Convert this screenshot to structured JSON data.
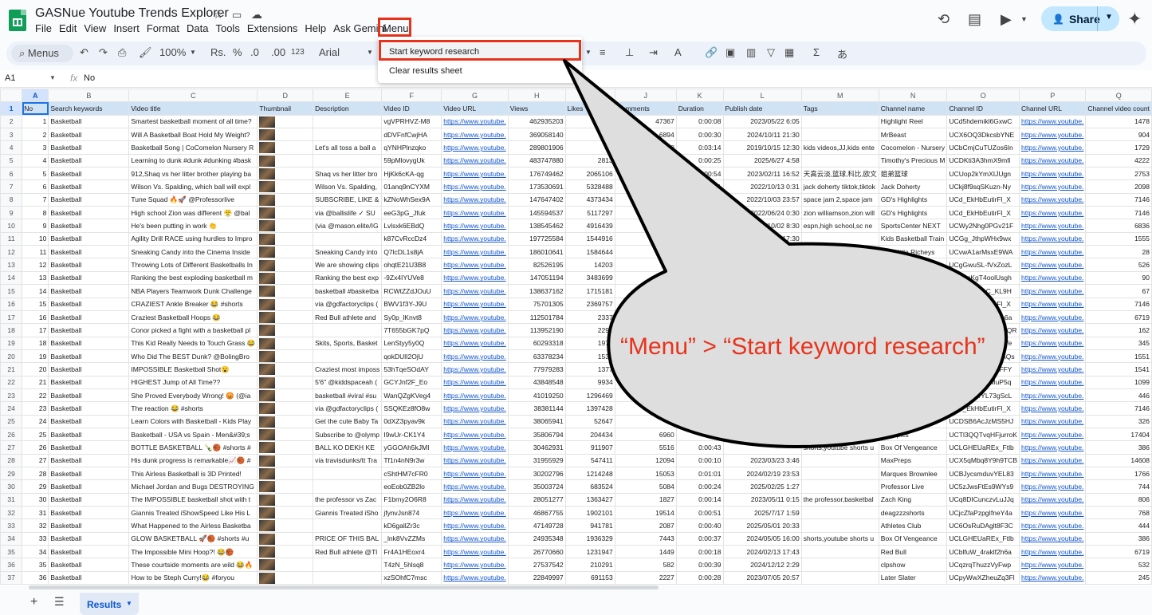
{
  "app": {
    "title": "GASNue Youtube Trends Explorer",
    "menu": [
      "File",
      "Edit",
      "View",
      "Insert",
      "Format",
      "Data",
      "Tools",
      "Extensions",
      "Help",
      "Ask Gemini"
    ],
    "custom_menu": "Menu",
    "share_label": "Share"
  },
  "toolbar": {
    "search_label": "Menus",
    "zoom": "100%",
    "currency": "Rs.",
    "percent": "%",
    "dec_decrease": ".0",
    "dec_increase": ".00",
    "number_format": "123",
    "font": "Arial",
    "input_tool": "あ"
  },
  "formula_bar": {
    "cell_ref": "A1",
    "fx": "fx",
    "value": "No"
  },
  "dropdown": {
    "items": [
      "Start keyword research",
      "Clear results sheet"
    ]
  },
  "callout": {
    "text": "“Menu” > “Start keyword research”"
  },
  "sheet": {
    "column_letters": [
      "A",
      "B",
      "C",
      "D",
      "E",
      "F",
      "G",
      "H",
      "I",
      "J",
      "K",
      "L",
      "M",
      "N",
      "O",
      "P",
      "Q"
    ],
    "headers": [
      "No",
      "Search keywords",
      "Video title",
      "Thumbnail",
      "Description",
      "Video ID",
      "Video URL",
      "Views",
      "Likes",
      "Comments",
      "Duration",
      "Publish date",
      "Tags",
      "Channel name",
      "Channel ID",
      "Channel URL",
      "Channel video count"
    ],
    "rows": [
      [
        "1",
        "Basketball",
        "Smartest basketball moment of all time?",
        "",
        "",
        "vgVPRHVZ-M8",
        "https://www.youtube.",
        "462935203",
        "",
        "47367",
        "0:00:08",
        "2023/05/22 6:05",
        "",
        "Highlight Reel",
        "UCd5hdemikl6GxwC",
        "https://www.youtube.",
        "1478"
      ],
      [
        "2",
        "Basketball",
        "Will A Basketball Boat Hold My Weight?",
        "",
        "",
        "dDVFnfCwjHA",
        "https://www.youtube.",
        "369058140",
        "",
        "6894",
        "0:00:30",
        "2024/10/11 21:30",
        "",
        "MrBeast",
        "UCX6OQ3DkcsbYNE",
        "https://www.youtube.",
        "904"
      ],
      [
        "3",
        "Basketball",
        "Basketball Song | CoComelon Nursery R",
        "",
        "Let's all toss a ball a",
        "qYNHPlnzqko",
        "https://www.youtube.",
        "289801906",
        "",
        "0",
        "0:03:14",
        "2019/10/15 12:30",
        "kids videos,JJ,kids ente",
        "Cocomelon - Nursery",
        "UCbCmjCuTUZos6In",
        "https://www.youtube.",
        "1729"
      ],
      [
        "4",
        "Basketball",
        "Learning to dunk #dunk #dunking #bask",
        "",
        "",
        "59pMlovygUk",
        "https://www.youtube.",
        "483747880",
        "2813",
        "",
        "0:00:25",
        "2025/6/27 4:58",
        "",
        "Timothy's Precious M",
        "UCDKti3A3hmX9mfi",
        "https://www.youtube.",
        "4222"
      ],
      [
        "5",
        "Basketball",
        "912,Shaq vs her litter brother playing ba",
        "",
        "Shaq vs her litter bro",
        "HjKk6cKA-qg",
        "https://www.youtube.",
        "176749462",
        "2065106",
        "",
        "0:00:54",
        "2023/02/11 16:52",
        "天高云淡,篮球,科比,欧文",
        "姐弟篮球",
        "UCUop2kYmXIJUgn",
        "https://www.youtube.",
        "2753"
      ],
      [
        "6",
        "Basketball",
        "Wilson Vs. Spalding, which ball will expl",
        "",
        "Wilson Vs. Spalding,",
        "01anq9nCYXM",
        "https://www.youtube.",
        "173530691",
        "5328488",
        "",
        "0:00:51",
        "2022/10/13 0:31",
        "jack doherty tiktok,tiktok",
        "Jack Doherty",
        "UCkj8f9sqSKuzn-Ny",
        "https://www.youtube.",
        "2098"
      ],
      [
        "7",
        "Basketball",
        "Tune Squad 🔥🚀 @Professorlive",
        "",
        "SUBSCRIBE, LIKE &",
        "kZNoWhSex9A",
        "https://www.youtube.",
        "147647402",
        "4373434",
        "",
        "0:00:29",
        "2022/10/03 23:57",
        "space jam 2,space jam",
        "GD's Highlights",
        "UCd_EkHbEutirFl_X",
        "https://www.youtube.",
        "7146"
      ],
      [
        "8",
        "Basketball",
        "High school Zion was different 😤 @bal",
        "",
        "via @ballislife ✓ SU",
        "eeG3pG_Jfuk",
        "https://www.youtube.",
        "145594537",
        "5117297",
        "",
        "0:00:47",
        "2022/06/24 0:30",
        "zion williamson,zion will",
        "GD's Highlights",
        "UCd_EkHbEutirFl_X",
        "https://www.youtube.",
        "7146"
      ],
      [
        "9",
        "Basketball",
        "He's been putting in work 👏",
        "",
        "(via @mason.elite/IG",
        "Lvlsxk6EBdQ",
        "https://www.youtube.",
        "138545462",
        "4916439",
        "",
        "0:00:59",
        "2022/10/02 8:30",
        "espn,high school,sc ne",
        "SportsCenter NEXT",
        "UCWy2Nhg0PGv21F",
        "https://www.youtube.",
        "6836"
      ],
      [
        "10",
        "Basketball",
        "Agility Drill RACE using hurdles to Impro",
        "",
        "",
        "k87CvRccDz4",
        "https://www.youtube.",
        "197725584",
        "1544916",
        "",
        "0:00:30",
        "2024/05/13 17:30",
        "",
        "Kids Basketball Train",
        "UCGg_JthpWHx9wx",
        "https://www.youtube.",
        "1555"
      ],
      [
        "11",
        "Basketball",
        "Sneaking Candy into the Cinema Inside",
        "",
        "Sneaking Candy into",
        "Q7lcDL1s8jA",
        "https://www.youtube.",
        "186010641",
        "1584644",
        "",
        "",
        "",
        "",
        "The Little Richeys",
        "UCvwA1arMsxE9WA",
        "https://www.youtube.",
        "28"
      ],
      [
        "12",
        "Basketball",
        "Throwing Lots of Different Basketballs In",
        "",
        "We are showing clips",
        "ohqtE21U3B8",
        "https://www.youtube.",
        "82526195",
        "14203",
        "",
        "",
        "",
        "",
        "Dyssa The E",
        "UCgGwuSL-fVxZozL",
        "https://www.youtube.",
        "526"
      ],
      [
        "13",
        "Basketball",
        "Ranking the best exploding basketball m",
        "",
        "Ranking the best exp",
        "-9Zx4IYUVe8",
        "https://www.youtube.",
        "147051194",
        "3483699",
        "",
        "",
        "",
        "",
        "",
        "UCCkcKgT4oolUsgh",
        "https://www.youtube.",
        "90"
      ],
      [
        "14",
        "Basketball",
        "NBA Players Teamwork Dunk Challenge",
        "",
        "basketball #basketba",
        "RCWtZZdJOuU",
        "https://www.youtube.",
        "138637162",
        "1715181",
        "",
        "",
        "",
        "",
        "",
        "UCiI7I9TjU1C_KL9H",
        "https://www.youtube.",
        "67"
      ],
      [
        "15",
        "Basketball",
        "CRAZIEST Ankle Breaker 😂 #shorts",
        "",
        "via @gdfactoryclips (",
        "BWV1f3Y-J9U",
        "https://www.youtube.",
        "75701305",
        "2369757",
        "",
        "",
        "",
        "",
        "",
        "UCd_EkHbEutirFl_X",
        "https://www.youtube.",
        "7146"
      ],
      [
        "16",
        "Basketball",
        "Craziest Basketball Hoops 😂",
        "",
        "Red Bull athlete and",
        "Sy0p_lKnvt8",
        "https://www.youtube.",
        "112501784",
        "2337",
        "",
        "",
        "",
        "",
        "",
        "UCbIfuW_4raklf2h6a",
        "https://www.youtube.",
        "6719"
      ],
      [
        "17",
        "Basketball",
        "Conor picked a fight with a basketball pl",
        "",
        "",
        "7T655bGK7pQ",
        "https://www.youtube.",
        "113952190",
        "2294",
        "",
        "",
        "",
        "",
        "",
        "UCmt9dmYTQgFQQR",
        "https://www.youtube.",
        "162"
      ],
      [
        "18",
        "Basketball",
        "This Kid Really Needs to Touch Grass 😂",
        "",
        "Skits, Sports, Basket",
        "LenStyy5y0Q",
        "https://www.youtube.",
        "60293318",
        "1972",
        "",
        "",
        "",
        "",
        "",
        "UCdf6Kmm9uXZqVe",
        "https://www.youtube.",
        "345"
      ],
      [
        "19",
        "Basketball",
        "Who Did The BEST Dunk? @BolingBro",
        "",
        "",
        "qokDUlI2OjU",
        "https://www.youtube.",
        "63378234",
        "1535",
        "",
        "",
        "",
        "",
        "",
        "UCBNXPipncPnzAQs",
        "https://www.youtube.",
        "1551"
      ],
      [
        "20",
        "Basketball",
        "IMPOSSIBLE Basketball Shot😮",
        "",
        "Craziest most imposs",
        "53hTqeSOdAY",
        "https://www.youtube.",
        "77979283",
        "1377",
        "",
        "",
        "",
        "",
        "",
        "UCcmXsu6cN4LFFY",
        "https://www.youtube.",
        "1541"
      ],
      [
        "21",
        "Basketball",
        "HIGHEST Jump of All Time??",
        "",
        "5'6\" @kiddspaceah (",
        "GCYJnf2F_Eo",
        "https://www.youtube.",
        "43848548",
        "9934",
        "",
        "",
        "",
        "",
        "",
        "UCZK4NpV4jMuP5q",
        "https://www.youtube.",
        "1099"
      ],
      [
        "22",
        "Basketball",
        "She Proved Everybody Wrong! 😡 (@ia",
        "",
        "basketball #viral #su",
        "WanQZgKVeg4",
        "https://www.youtube.",
        "41019250",
        "1296469",
        "",
        "",
        "",
        "",
        "",
        "UCbc1UerYL73gScL",
        "https://www.youtube.",
        "446"
      ],
      [
        "23",
        "Basketball",
        "The reaction 😂 #shorts",
        "",
        "via @gdfactoryclips (",
        "SSQKEz8fO8w",
        "https://www.youtube.",
        "38381144",
        "1397428",
        "",
        "",
        "",
        "",
        "",
        "UCd_EkHbEutirFl_X",
        "https://www.youtube.",
        "7146"
      ],
      [
        "24",
        "Basketball",
        "Learn Colors with Basketball - Kids Play",
        "",
        "Get the cute Baby Ta",
        "0dXZ3pyav9k",
        "https://www.youtube.",
        "38065941",
        "52647",
        "",
        "",
        "",
        "",
        "by ChuChu",
        "UCDSB6AcJzMS5HJ",
        "https://www.youtube.",
        "326"
      ],
      [
        "25",
        "Basketball",
        "Basketball - USA vs Spain - Men&#39;s",
        "",
        "Subscribe to @olymp",
        "I9wUr-CK1Y4",
        "https://www.youtube.",
        "35806794",
        "204434",
        "6960",
        "",
        "",
        "",
        "Olympics",
        "UCTl3QQTvqHFjurroK",
        "https://www.youtube.",
        "17404"
      ],
      [
        "26",
        "Basketball",
        "BOTTLE BASKETBALL 🍾🏀 #shorts #",
        "",
        "BALL KO DEKH KE",
        "yGGOAh5kJMI",
        "https://www.youtube.",
        "30462931",
        "911907",
        "5516",
        "0:00:43",
        "",
        "shorts,youtube shorts u",
        "Box Of Vengeance",
        "UCLGHEUaREx_Ftlb",
        "https://www.youtube.",
        "386"
      ],
      [
        "27",
        "Basketball",
        "His dunk progress is remarkable📈🏀 #",
        "",
        "via travisdunks/tt Tra",
        "Tf1n4nN9r3w",
        "https://www.youtube.",
        "31955929",
        "547411",
        "12094",
        "0:00:10",
        "2023/03/23 3:46",
        "",
        "MaxPreps",
        "UCX5qMbq8Y9h9TCB",
        "https://www.youtube.",
        "14608"
      ],
      [
        "28",
        "Basketball",
        "This Airless Basketball is 3D Printed!",
        "",
        "",
        "cShtHM7cFR0",
        "https://www.youtube.",
        "30202796",
        "1214248",
        "15053",
        "0:01:01",
        "2024/02/19 23:53",
        "",
        "Marques Brownlee",
        "UCBJycsmduvYEL83",
        "https://www.youtube.",
        "1766"
      ],
      [
        "29",
        "Basketball",
        "Michael Jordan and Bugs DESTROYING",
        "",
        "",
        "eoEob0ZB2lo",
        "https://www.youtube.",
        "35003724",
        "683524",
        "5084",
        "0:00:24",
        "2025/02/25 1:27",
        "",
        "Professor Live",
        "UC5zJwsFtEs9WYs9",
        "https://www.youtube.",
        "744"
      ],
      [
        "30",
        "Basketball",
        "The IMPOSSIBLE basketball shot with t",
        "",
        "the professor vs Zac",
        "F1brny2O6R8",
        "https://www.youtube.",
        "28051277",
        "1363427",
        "1827",
        "0:00:14",
        "2023/05/11 0:15",
        "the professor,basketbal",
        "Zach King",
        "UCq8DICunczvLuJJq",
        "https://www.youtube.",
        "806"
      ],
      [
        "31",
        "Basketball",
        "Giannis Treated iShowSpeed Like His L",
        "",
        "Giannis Treated iSho",
        "jfynvJsn874",
        "https://www.youtube.",
        "46867755",
        "1902101",
        "19514",
        "0:00:51",
        "2025/7/17 1:59",
        "",
        "deagzzzshorts",
        "UCjcZfaPzpgIfneY4a",
        "https://www.youtube.",
        "768"
      ],
      [
        "32",
        "Basketball",
        "What Happened to the Airless Basketba",
        "",
        "",
        "kD6gallZr3c",
        "https://www.youtube.",
        "47149728",
        "941781",
        "2087",
        "0:00:40",
        "2025/05/01 20:33",
        "",
        "Athletes Club",
        "UC6OsRuDAglt8F3C",
        "https://www.youtube.",
        "444"
      ],
      [
        "33",
        "Basketball",
        "GLOW BASKETBALL 🚀🏀 #shorts #u",
        "",
        "PRICE OF THIS BAL",
        "_lnk8VvZZMs",
        "https://www.youtube.",
        "24935348",
        "1936329",
        "7443",
        "0:00:37",
        "2024/05/05 16:00",
        "shorts,youtube shorts u",
        "Box Of Vengeance",
        "UCLGHEUaREx_Ftlb",
        "https://www.youtube.",
        "386"
      ],
      [
        "34",
        "Basketball",
        "The Impossible Mini Hoop?! 😂🏀",
        "",
        "Red Bull athlete @Tl",
        "Fr4A1HEoxr4",
        "https://www.youtube.",
        "26770660",
        "1231947",
        "1449",
        "0:00:18",
        "2024/02/13 17:43",
        "",
        "Red Bull",
        "UCblfuW_4raklf2h6a",
        "https://www.youtube.",
        "6719"
      ],
      [
        "35",
        "Basketball",
        "These courtside moments are wild 😂🔥",
        "",
        "",
        "T4zN_5hlsq8",
        "https://www.youtube.",
        "27537542",
        "210291",
        "582",
        "0:00:39",
        "2024/12/12 2:29",
        "",
        "clpshow",
        "UCqzrqThuzzVyFwp",
        "https://www.youtube.",
        "532"
      ],
      [
        "36",
        "Basketball",
        "How to be Steph Curry!😂 #foryou",
        "",
        "",
        "xzSOhfC7msc",
        "https://www.youtube.",
        "22849997",
        "691153",
        "2227",
        "0:00:28",
        "2023/07/05 20:57",
        "",
        "Later Slater",
        "UCpyWwXZheuZq3Fl",
        "https://www.youtube.",
        "245"
      ]
    ]
  },
  "sheet_tabs": {
    "active": "Results"
  }
}
